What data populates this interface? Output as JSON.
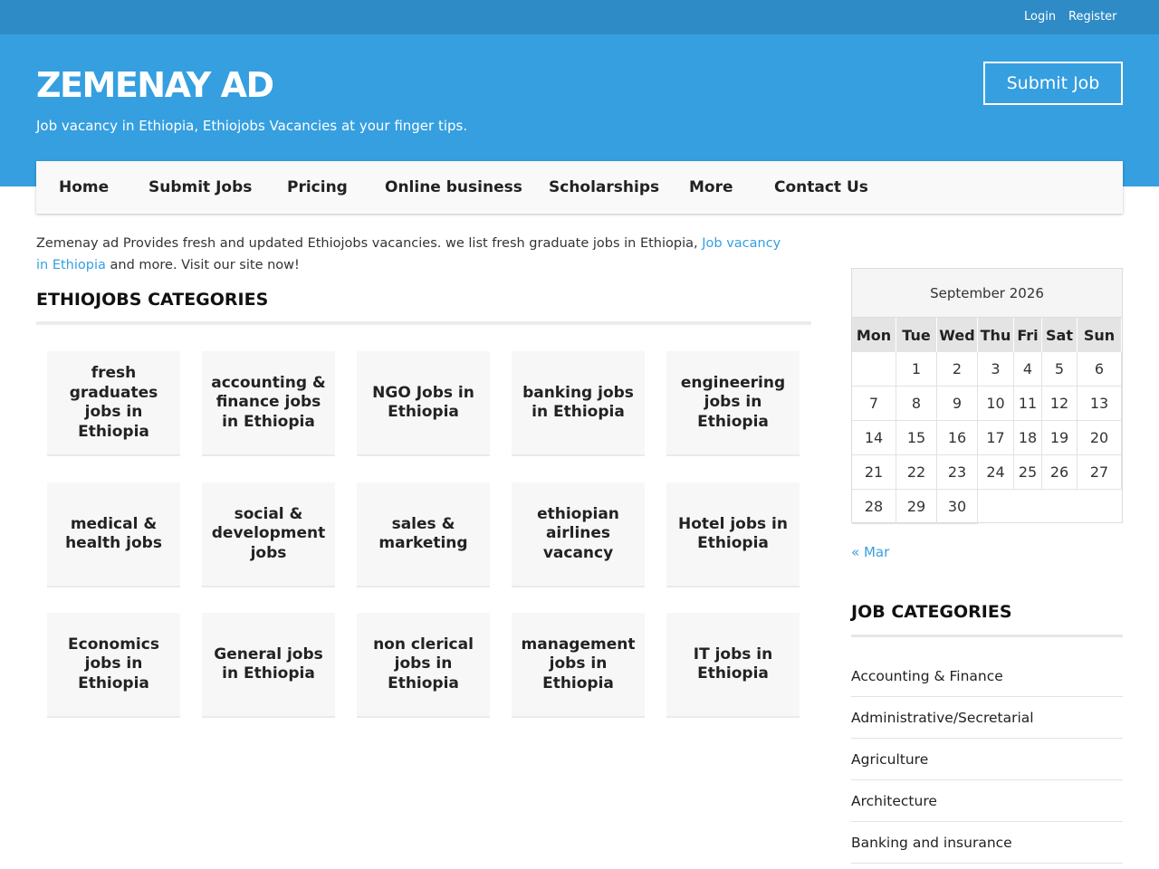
{
  "topbar": {
    "login": "Login",
    "register": "Register"
  },
  "header": {
    "site_title": "ZEMENAY AD",
    "tagline": "Job vacancy in Ethiopia, Ethiojobs Vacancies at your finger tips.",
    "submit_job": "Submit Job"
  },
  "nav": [
    "Home",
    "Submit Jobs",
    "Pricing",
    "Online business",
    "Scholarships",
    "More",
    "Contact Us"
  ],
  "intro": {
    "text_before": "Zemenay ad Provides fresh and updated Ethiojobs vacancies. we list fresh graduate jobs in Ethiopia, ",
    "link_text": "Job vacancy in Ethiopia",
    "text_after": " and more. Visit our site now!"
  },
  "categories_heading": "ETHIOJOBS CATEGORIES",
  "categories": [
    "fresh graduates jobs in Ethiopia",
    "accounting & finance jobs in Ethiopia",
    "NGO Jobs in Ethiopia",
    "banking jobs in Ethiopia",
    "engineering jobs in Ethiopia",
    "medical & health jobs",
    "social & development jobs",
    "sales & marketing",
    "ethiopian airlines vacancy",
    "Hotel jobs in Ethiopia",
    "Economics jobs in Ethiopia",
    "General jobs in Ethiopia",
    "non clerical jobs in Ethiopia",
    "management jobs in Ethiopia",
    "IT jobs in Ethiopia"
  ],
  "calendar": {
    "caption": "September 2026",
    "weekdays": [
      "Mon",
      "Tue",
      "Wed",
      "Thu",
      "Fri",
      "Sat",
      "Sun"
    ],
    "weeks": [
      [
        "",
        "1",
        "2",
        "3",
        "4",
        "5",
        "6"
      ],
      [
        "7",
        "8",
        "9",
        "10",
        "11",
        "12",
        "13"
      ],
      [
        "14",
        "15",
        "16",
        "17",
        "18",
        "19",
        "20"
      ],
      [
        "21",
        "22",
        "23",
        "24",
        "25",
        "26",
        "27"
      ],
      [
        "28",
        "29",
        "30",
        "",
        "",
        "",
        ""
      ]
    ],
    "prev_link": "« Mar"
  },
  "job_categories_heading": "JOB CATEGORIES",
  "job_categories": [
    "Accounting & Finance",
    "Administrative/Secretarial",
    "Agriculture",
    "Architecture",
    "Banking and insurance"
  ],
  "colors": {
    "topbar": "#2e8bc6",
    "hero": "#359fe0",
    "link": "#359fe0"
  }
}
